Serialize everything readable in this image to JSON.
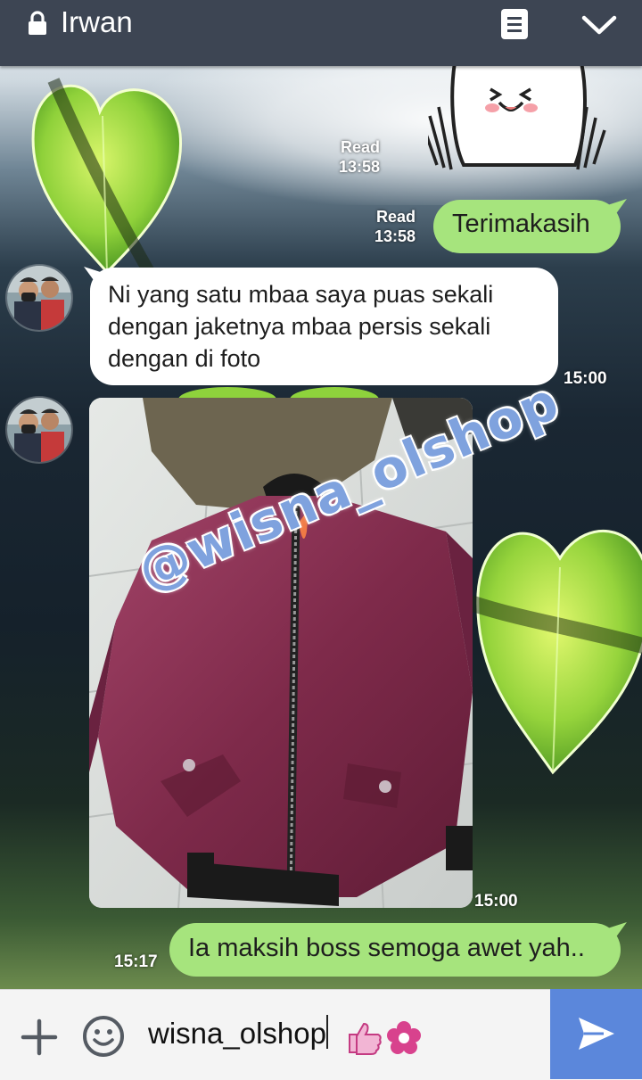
{
  "header": {
    "contact_name": "Irwan",
    "icons": [
      "lock-icon",
      "notes-icon",
      "chevron-down-icon"
    ]
  },
  "messages": [
    {
      "type": "sticker",
      "side": "out",
      "sticker": "cony-laughing",
      "read": "Read",
      "time": "13:58"
    },
    {
      "type": "text",
      "side": "out",
      "text": "Terimakasih",
      "read": "Read",
      "time": "13:58"
    },
    {
      "type": "text",
      "side": "in",
      "lines": [
        "Ni yang satu mbaa saya puas sekali",
        "dengan jaketnya mbaa persis sekali",
        "dengan di foto"
      ],
      "time": "15:00"
    },
    {
      "type": "image",
      "side": "in",
      "watermark": "@wisna_olshop",
      "time": "15:00"
    },
    {
      "type": "text",
      "side": "out",
      "text": "Ia maksih boss semoga awet yah..",
      "time": "15:17"
    }
  ],
  "composer": {
    "value": "wisna_olshop",
    "icons": [
      "plus-icon",
      "emoji-icon",
      "thumbs-up-emoji",
      "flower-emoji",
      "send-icon"
    ]
  },
  "colors": {
    "header": "#3d4553",
    "outgoing_bubble": "#a6e47d",
    "incoming_bubble": "#ffffff",
    "send_button": "#5b87db",
    "watermark": "#7fa2de"
  }
}
